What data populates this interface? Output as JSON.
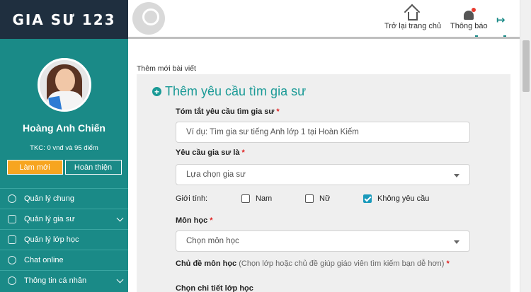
{
  "brand": {
    "logo": "GIA SƯ 123"
  },
  "profile": {
    "name": "Hoàng Anh Chiến",
    "balance": "TKC: 0 vnđ và 95 điểm",
    "btn_new": "Làm mới",
    "btn_complete": "Hoàn thiện"
  },
  "sidebar": {
    "items": [
      {
        "label": "Quản lý chung",
        "icon": "gear-icon",
        "chevron": false
      },
      {
        "label": "Quản lý gia sư",
        "icon": "tutor-icon",
        "chevron": true
      },
      {
        "label": "Quản lý lớp học",
        "icon": "class-icon",
        "chevron": false
      },
      {
        "label": "Chat online",
        "icon": "chat-icon",
        "chevron": false
      },
      {
        "label": "Thông tin cá nhân",
        "icon": "user-icon",
        "chevron": true
      }
    ]
  },
  "header": {
    "home_label": "Trở lại trang chủ",
    "notify_label": "Thông báo",
    "logout_glyph": "↦"
  },
  "breadcrumb": "Thêm mới bài viết",
  "form": {
    "title": "Thêm yêu cầu tìm gia sư",
    "summary_label": "Tóm tắt yêu cầu tìm gia sư",
    "summary_placeholder": "Ví dụ: Tìm gia sư tiếng Anh lớp 1 tại Hoàn Kiếm",
    "tutor_type_label": "Yêu cầu gia sư là",
    "tutor_type_value": "Lựa chọn gia sư",
    "gender_label": "Giới tính:",
    "gender_options": [
      {
        "label": "Nam",
        "checked": false
      },
      {
        "label": "Nữ",
        "checked": false
      },
      {
        "label": "Không yêu cầu",
        "checked": true
      }
    ],
    "subject_label": "Môn học",
    "subject_value": "Chọn môn học",
    "topic_label": "Chủ đề môn học",
    "topic_hint": "(Chọn lớp hoặc chủ đề giúp giáo viên tìm kiếm bạn dễ hơn)",
    "class_detail_label": "Chọn chi tiết lớp học",
    "required_mark": "*"
  },
  "colors": {
    "accent": "#1a8a87",
    "header_dark": "#1f2f3f",
    "orange": "#f7a520",
    "required": "#e02020"
  }
}
